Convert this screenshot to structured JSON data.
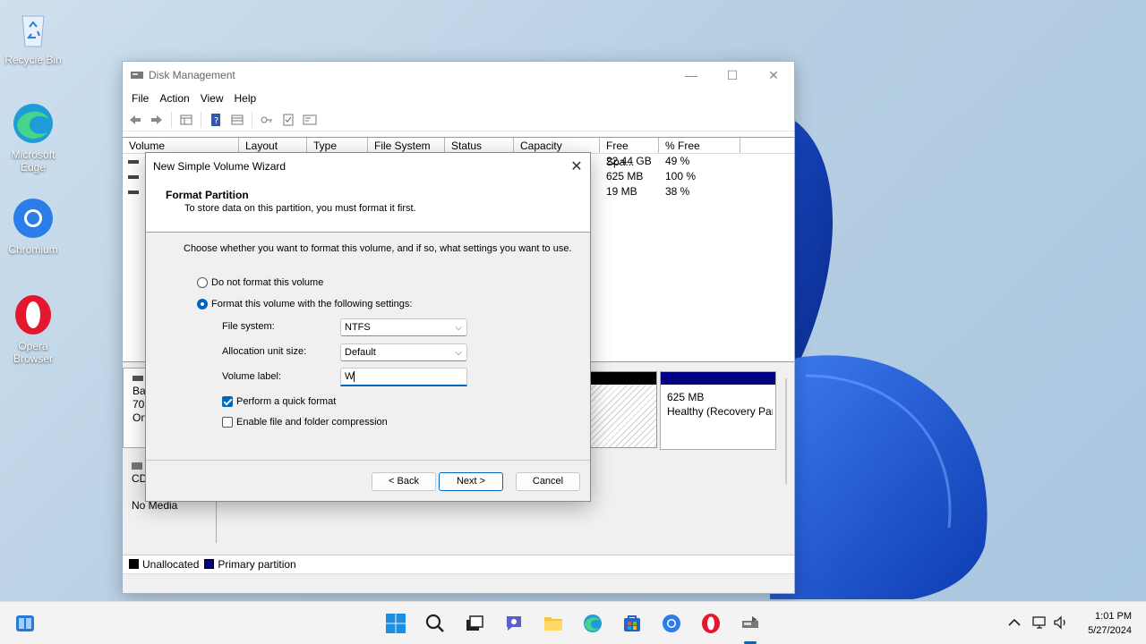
{
  "desktop": {
    "icons": [
      {
        "label": "Recycle Bin",
        "icon": "recycle-bin-icon"
      },
      {
        "label": "Microsoft Edge",
        "icon": "edge-icon"
      },
      {
        "label": "Chromium",
        "icon": "chromium-icon"
      },
      {
        "label": "Opera Browser",
        "icon": "opera-icon"
      }
    ]
  },
  "window": {
    "title": "Disk Management",
    "menu": [
      "File",
      "Action",
      "View",
      "Help"
    ],
    "columns": [
      "Volume",
      "Layout",
      "Type",
      "File System",
      "Status",
      "Capacity",
      "Free Spa...",
      "% Free"
    ],
    "rows": [
      {
        "free": "22.44 GB",
        "pct": "49 %"
      },
      {
        "free": "625 MB",
        "pct": "100 %"
      },
      {
        "free": "19 MB",
        "pct": "38 %"
      }
    ],
    "disk0": {
      "name": "Ba",
      "size": "70.",
      "state": "On"
    },
    "recovery_partition": {
      "size": "625 MB",
      "status": "Healthy (Recovery Par"
    },
    "cdrom": {
      "name": "CD",
      "state": "No Media"
    },
    "legend": {
      "unallocated": "Unallocated",
      "primary": "Primary partition"
    }
  },
  "wizard": {
    "title": "New Simple Volume Wizard",
    "heading": "Format Partition",
    "subheading": "To store data on this partition, you must format it first.",
    "description": "Choose whether you want to format this volume, and if so, what settings you want to use.",
    "radio_no_format": "Do not format this volume",
    "radio_format": "Format this volume with the following settings:",
    "file_system_label": "File system:",
    "file_system_value": "NTFS",
    "allocation_label": "Allocation unit size:",
    "allocation_value": "Default",
    "volume_label_label": "Volume label:",
    "volume_label_value": "W",
    "quick_format": "Perform a quick format",
    "compression": "Enable file and folder compression",
    "back": "< Back",
    "next": "Next >",
    "cancel": "Cancel"
  },
  "taskbar": {
    "time": "1:01 PM",
    "date": "5/27/2024"
  },
  "colors": {
    "accent": "#0067c0",
    "primary_partition": "#000080"
  }
}
